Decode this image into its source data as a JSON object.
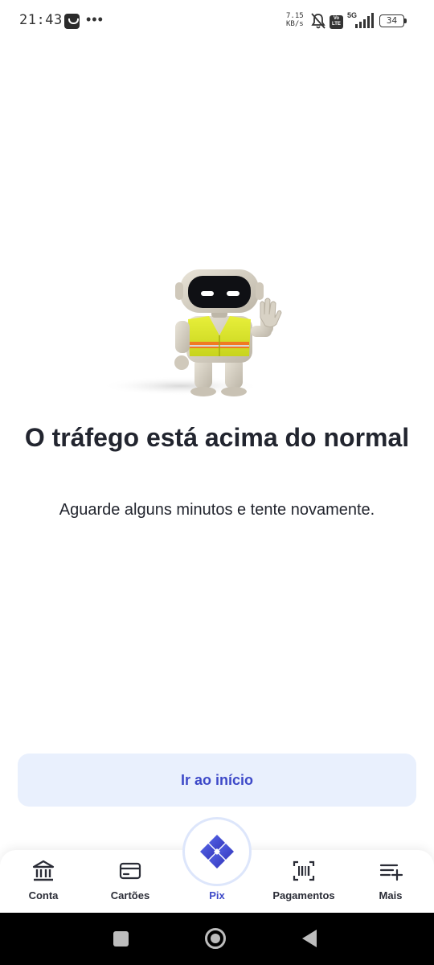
{
  "status_bar": {
    "time": "21:43",
    "network_speed_value": "7.15",
    "network_speed_unit": "KB/s",
    "volte_label": "Vo LTE",
    "network_type": "5G",
    "battery_level": "34",
    "icons": [
      "app-notification-icon",
      "more-dots-icon",
      "mute-bell-icon",
      "volte-icon",
      "signal-icon",
      "battery-icon"
    ]
  },
  "error": {
    "title": "O tráfego está acima do normal",
    "subtitle": "Aguarde alguns minutos e tente novamente."
  },
  "actions": {
    "home_button_label": "Ir ao início"
  },
  "bottom_nav": {
    "items": [
      {
        "label": "Conta",
        "icon": "bank-icon"
      },
      {
        "label": "Cartões",
        "icon": "card-icon"
      },
      {
        "label": "Pix",
        "icon": "pix-icon",
        "active": true
      },
      {
        "label": "Pagamentos",
        "icon": "barcode-scan-icon"
      },
      {
        "label": "Mais",
        "icon": "menu-plus-icon"
      }
    ]
  },
  "colors": {
    "accent": "#3d49c8",
    "button_bg": "#e9f0fd",
    "title_text": "#22252f",
    "pix_gradient_start": "#4f5fe0",
    "pix_gradient_end": "#3a3fc0"
  }
}
